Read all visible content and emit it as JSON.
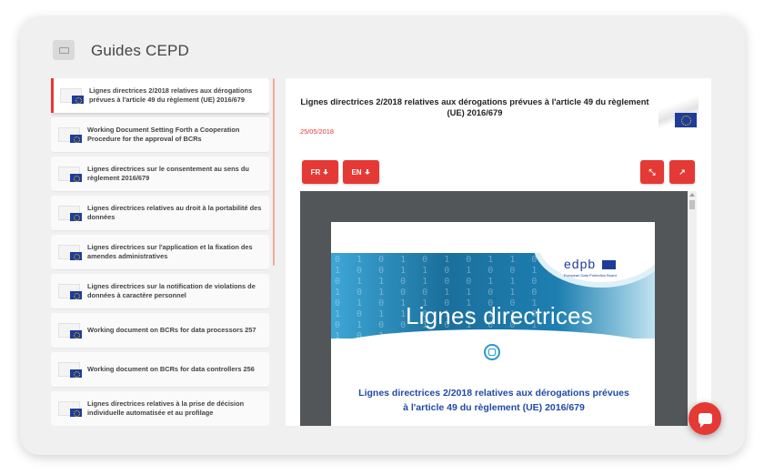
{
  "app": {
    "title": "Guides CEPD",
    "header_icon": "folder-icon"
  },
  "list": {
    "items": [
      {
        "label": "Lignes directrices 2/2018 relatives aux dérogations prévues à l'article 49 du règlement (UE) 2016/679",
        "active": true
      },
      {
        "label": "Working Document Setting Forth a Cooperation Procedure for the approval of BCRs",
        "active": false
      },
      {
        "label": "Lignes directrices sur le consentement au sens du règlement 2016/679",
        "active": false
      },
      {
        "label": "Lignes directrices relatives au droit à la portabilité des données",
        "active": false
      },
      {
        "label": "Lignes directrices sur l'application et la fixation des amendes administratives",
        "active": false
      },
      {
        "label": "Lignes directrices sur la notification de violations de données à caractère personnel",
        "active": false
      },
      {
        "label": "Working document on BCRs for data processors 257",
        "active": false
      },
      {
        "label": "Working document on BCRs for data controllers 256",
        "active": false
      },
      {
        "label": "Lignes directrices relatives à la prise de décision individuelle automatisée et au profilage",
        "active": false
      }
    ]
  },
  "detail": {
    "title": "Lignes directrices 2/2018 relatives aux dérogations prévues à l'article 49 du règlement (UE) 2016/679",
    "date": "25/05/2018",
    "buttons": {
      "fr_label": "FR",
      "en_label": "EN",
      "compress_icon": "compress-icon",
      "open_icon": "external-link-icon"
    },
    "document": {
      "brand": "edpb",
      "brand_sub": "European Data Protection Board",
      "banner_title": "Lignes directrices",
      "heading_line1": "Lignes directrices 2/2018 relatives aux dérogations prévues",
      "heading_line2": "à l'article 49 du règlement (UE) 2016/679"
    }
  },
  "colors": {
    "accent": "#e53935",
    "doc_heading": "#1f4aa8",
    "eu_blue": "#1f3c99"
  },
  "chat": {
    "icon": "chat-icon"
  }
}
